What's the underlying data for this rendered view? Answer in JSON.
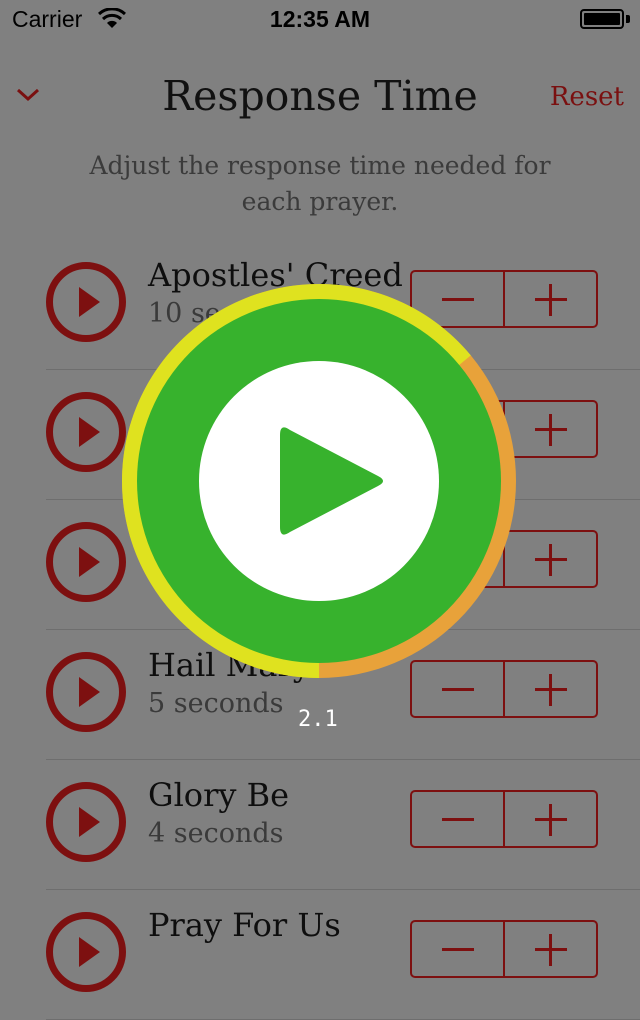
{
  "status_bar": {
    "carrier": "Carrier",
    "time": "12:35 AM"
  },
  "header": {
    "title": "Response Time",
    "reset_label": "Reset"
  },
  "subtitle": "Adjust the response time needed for each prayer.",
  "prayers": [
    {
      "name": "Apostles' Creed",
      "seconds": "10 seconds"
    },
    {
      "name": "",
      "seconds": ""
    },
    {
      "name": "",
      "seconds": ""
    },
    {
      "name": "Hail Mary",
      "seconds": "5 seconds"
    },
    {
      "name": "Glory Be",
      "seconds": "4 seconds"
    },
    {
      "name": "Pray For Us",
      "seconds": ""
    }
  ],
  "overlay": {
    "counter": "2.1",
    "progress": 0.36
  },
  "colors": {
    "accent": "#7d1010",
    "overlay_green": "#37b22d",
    "ring_yellow": "#dfe21f",
    "ring_orange": "#e8a23a"
  }
}
